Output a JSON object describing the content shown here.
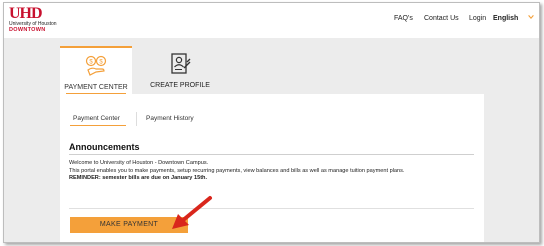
{
  "header": {
    "logo": {
      "mark": "UHD",
      "line1": "University of Houston",
      "line2": "DOWNTOWN"
    },
    "nav": {
      "faqs": "FAQ's",
      "contact": "Contact Us",
      "login": "Login",
      "language": "English"
    }
  },
  "tabs": [
    {
      "label": "PAYMENT CENTER",
      "icon": "payment-center-icon",
      "active": true
    },
    {
      "label": "CREATE PROFILE",
      "icon": "create-profile-icon",
      "active": false
    }
  ],
  "subtabs": {
    "payment_center": "Payment Center",
    "payment_history": "Payment History"
  },
  "announcements": {
    "title": "Announcements",
    "line1": "Welcome to University of Houston - Downtown Campus.",
    "line2": "This portal enables you to make payments, setup recurring payments, view balances and bills as well as manage tuition payment plans.",
    "reminder": "REMINDER: semester bills are due on January 15th."
  },
  "actions": {
    "make_payment": "MAKE PAYMENT"
  },
  "colors": {
    "accent": "#f4a03a",
    "brand_red": "#c8102e",
    "arrow_red": "#d9261c"
  }
}
